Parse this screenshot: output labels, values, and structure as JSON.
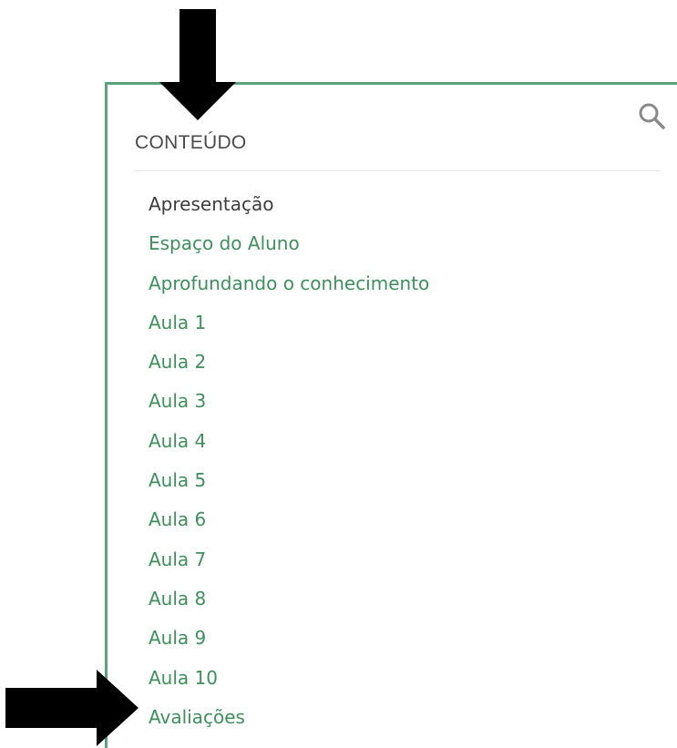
{
  "sidebar": {
    "header": "CONTEÚDO",
    "search_icon": "search-icon",
    "items": [
      {
        "label": "Apresentação",
        "state": "current"
      },
      {
        "label": "Espaço do Aluno",
        "state": "link"
      },
      {
        "label": "Aprofundando o conhecimento",
        "state": "link"
      },
      {
        "label": "Aula 1",
        "state": "link"
      },
      {
        "label": "Aula 2",
        "state": "link"
      },
      {
        "label": "Aula 3",
        "state": "link"
      },
      {
        "label": "Aula 4",
        "state": "link"
      },
      {
        "label": "Aula 5",
        "state": "link"
      },
      {
        "label": "Aula 6",
        "state": "link"
      },
      {
        "label": "Aula 7",
        "state": "link"
      },
      {
        "label": "Aula 8",
        "state": "link"
      },
      {
        "label": "Aula 9",
        "state": "link"
      },
      {
        "label": "Aula 10",
        "state": "link"
      },
      {
        "label": "Avaliações",
        "state": "link"
      }
    ]
  },
  "annotations": {
    "arrow_down_icon": "arrow-down-icon",
    "arrow_right_icon": "arrow-right-icon"
  },
  "colors": {
    "panel_border": "#5aa27c",
    "link": "#3f8f5d",
    "current": "#3d3d3d",
    "header_text": "#4a4a4a",
    "arrow": "#000000"
  }
}
